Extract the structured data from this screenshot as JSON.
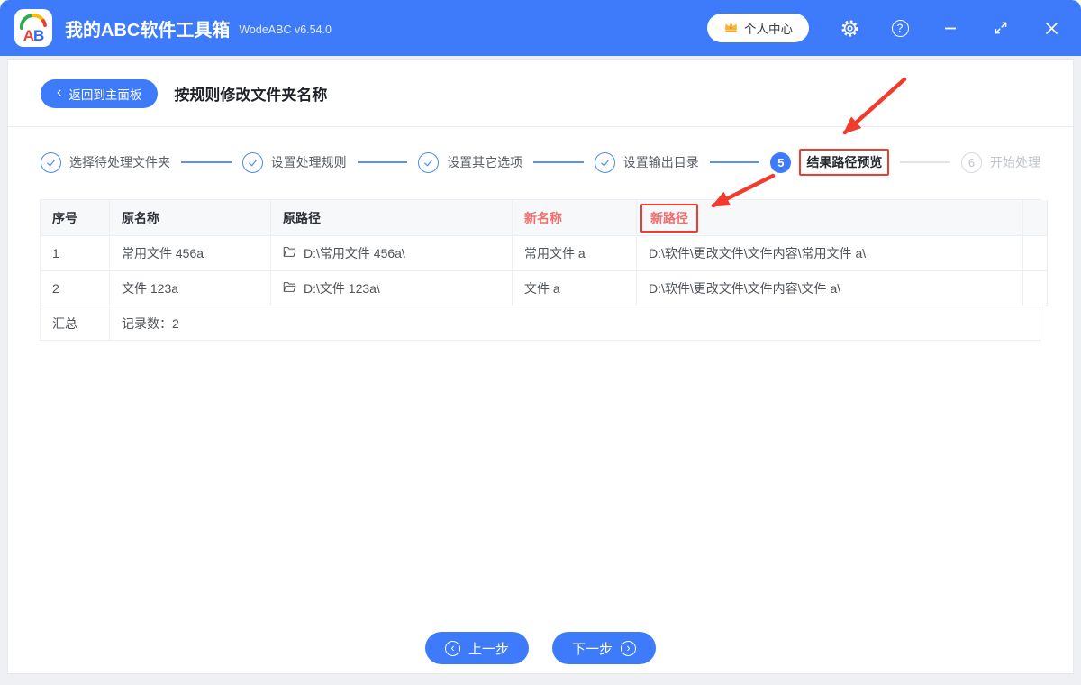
{
  "titlebar": {
    "logo": {
      "letter_a": "A",
      "letter_b": "B"
    },
    "app_name": "我的ABC软件工具箱",
    "version": "WodeABC v6.54.0",
    "user_center_label": "个人中心",
    "help_glyph": "?"
  },
  "header": {
    "back_chevron": "‹",
    "back_label": "返回到主面板",
    "page_title": "按规则修改文件夹名称"
  },
  "steps": {
    "items": [
      {
        "label": "选择待处理文件夹",
        "state": "done"
      },
      {
        "label": "设置处理规则",
        "state": "done"
      },
      {
        "label": "设置其它选项",
        "state": "done"
      },
      {
        "label": "设置输出目录",
        "state": "done"
      },
      {
        "label": "结果路径预览",
        "state": "current",
        "number": "5"
      },
      {
        "label": "开始处理",
        "state": "pending",
        "number": "6"
      }
    ]
  },
  "table": {
    "headers": {
      "index": "序号",
      "old_name": "原名称",
      "old_path": "原路径",
      "new_name": "新名称",
      "new_path": "新路径"
    },
    "rows": [
      {
        "index": "1",
        "old_name": "常用文件 456a",
        "old_path": "D:\\常用文件 456a\\",
        "new_name": "常用文件 a",
        "new_path": "D:\\软件\\更改文件\\文件内容\\常用文件 a\\"
      },
      {
        "index": "2",
        "old_name": "文件 123a",
        "old_path": "D:\\文件 123a\\",
        "new_name": "文件 a",
        "new_path": "D:\\软件\\更改文件\\文件内容\\文件 a\\"
      }
    ],
    "summary_label": "汇总",
    "summary_text": "记录数：2"
  },
  "footer": {
    "prev_glyph": "‹",
    "prev_label": "上一步",
    "next_label": "下一步",
    "next_glyph": "›"
  },
  "colors": {
    "titlebar_blue": "#3e7bfa",
    "step_blue": "#4a8cf7",
    "table_header_red": "#f56c6c",
    "annotation_red": "#f13b2d",
    "crown_gold": "#f5b52e",
    "table_border": "#ebeef5"
  }
}
